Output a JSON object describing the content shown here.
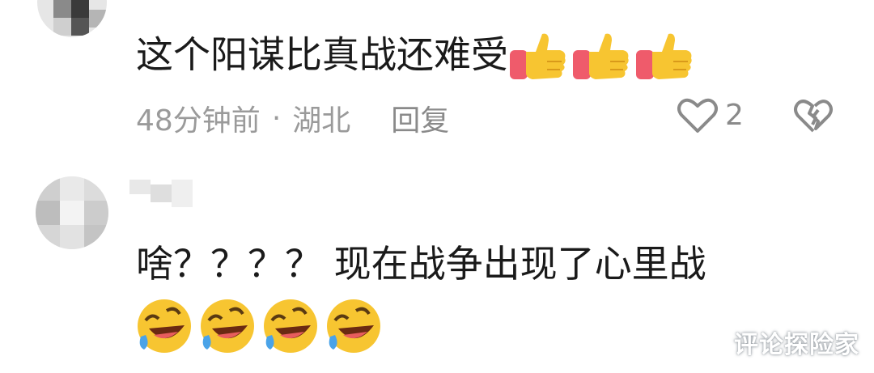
{
  "comments": [
    {
      "text": "这个阳谋比真战还难受",
      "emoji": [
        "thumbs-up",
        "thumbs-up",
        "thumbs-up"
      ],
      "time": "48分钟前",
      "separator": "·",
      "location": "湖北",
      "reply_label": "回复",
      "like_count": "2"
    },
    {
      "text": "啥？？？？ 现在战争出现了心里战",
      "emoji": [
        "rolling-laughing",
        "rolling-laughing",
        "rolling-laughing",
        "rolling-laughing"
      ]
    }
  ],
  "watermark": "评论探险家",
  "colors": {
    "meta_text": "#9a9a9a",
    "thumb_yellow": "#f7c531",
    "sleeve_pink": "#ef5b6b"
  }
}
